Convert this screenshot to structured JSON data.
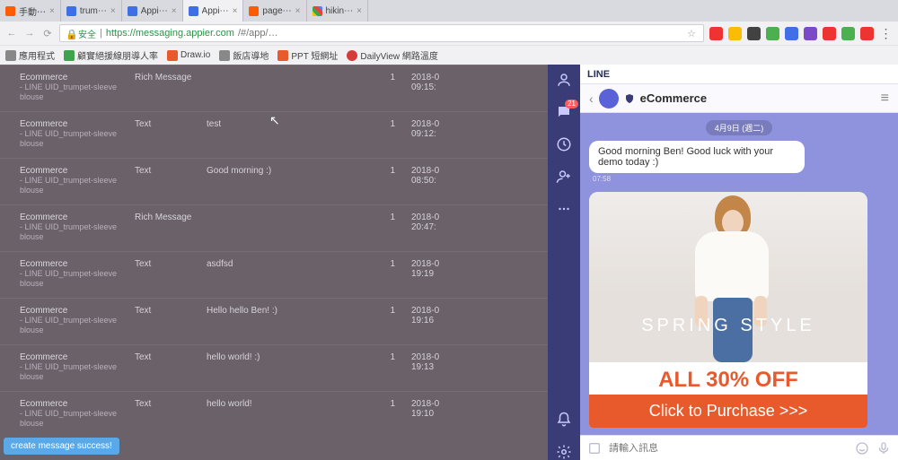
{
  "browser": {
    "tabs": [
      {
        "label": "手動⋯",
        "fav": "orange"
      },
      {
        "label": "trum⋯",
        "fav": "blue"
      },
      {
        "label": "Appi⋯",
        "fav": "blue"
      },
      {
        "label": "Appi⋯",
        "fav": "blue",
        "active": true
      },
      {
        "label": "page⋯",
        "fav": "orange"
      },
      {
        "label": "hikin⋯",
        "fav": "mc"
      }
    ],
    "secure_label": "安全",
    "url_host": "https://messaging.appier.com",
    "url_path": "/#/app/…",
    "bookmarks": [
      {
        "label": "應用程式"
      },
      {
        "label": "顧實絕援線朋導人率"
      },
      {
        "label": "Draw.io"
      },
      {
        "label": "飯店導地"
      },
      {
        "label": "PPT 短網址"
      },
      {
        "label": "DailyView 網路溫度"
      }
    ]
  },
  "messages": [
    {
      "seg_title": "Ecommerce",
      "seg_sub": "- LINE UID_trumpet-sleeve blouse",
      "type": "Rich Message",
      "content": "",
      "count": "1",
      "date": "2018-0",
      "time": "09:15:"
    },
    {
      "seg_title": "Ecommerce",
      "seg_sub": "- LINE UID_trumpet-sleeve blouse",
      "type": "Text",
      "content": "test",
      "count": "1",
      "date": "2018-0",
      "time": "09:12:"
    },
    {
      "seg_title": "Ecommerce",
      "seg_sub": "- LINE UID_trumpet-sleeve blouse",
      "type": "Text",
      "content": "Good morning :)",
      "count": "1",
      "date": "2018-0",
      "time": "08:50:"
    },
    {
      "seg_title": "Ecommerce",
      "seg_sub": "- LINE UID_trumpet-sleeve blouse",
      "type": "Rich Message",
      "content": "",
      "count": "1",
      "date": "2018-0",
      "time": "20:47:"
    },
    {
      "seg_title": "Ecommerce",
      "seg_sub": "- LINE UID_trumpet-sleeve blouse",
      "type": "Text",
      "content": "asdfsd",
      "count": "1",
      "date": "2018-0",
      "time": "19:19"
    },
    {
      "seg_title": "Ecommerce",
      "seg_sub": "- LINE UID_trumpet-sleeve blouse",
      "type": "Text",
      "content": "Hello hello Ben! :)",
      "count": "1",
      "date": "2018-0",
      "time": "19:16"
    },
    {
      "seg_title": "Ecommerce",
      "seg_sub": "- LINE UID_trumpet-sleeve blouse",
      "type": "Text",
      "content": "hello world! :)",
      "count": "1",
      "date": "2018-0",
      "time": "19:13"
    },
    {
      "seg_title": "Ecommerce",
      "seg_sub": "- LINE UID_trumpet-sleeve blouse",
      "type": "Text",
      "content": "hello world!",
      "count": "1",
      "date": "2018-0",
      "time": "19:10"
    }
  ],
  "toast": "create message success!",
  "line": {
    "app_title": "LINE",
    "chat_name": "eCommerce",
    "date_pill": "4月9日 (週二)",
    "bubble_text": "Good morning Ben! Good luck with your demo today :)",
    "bubble_time": "07:58",
    "promo_overlay": "SPRING STYLE",
    "promo_off": "ALL 30% OFF",
    "promo_cta": "Click to Purchase >>>",
    "input_placeholder": "請輸入訊息",
    "sidebar_badge": "21"
  }
}
